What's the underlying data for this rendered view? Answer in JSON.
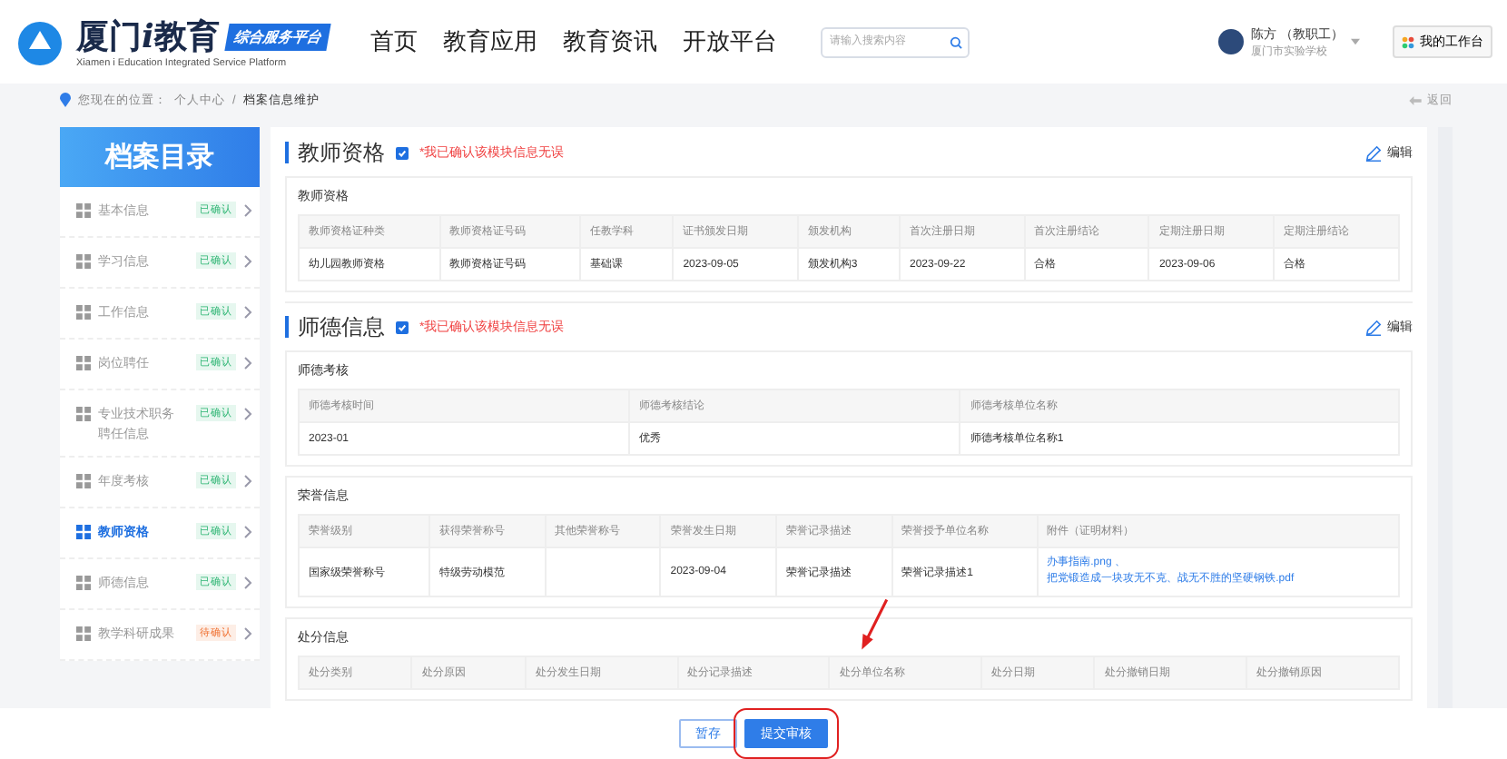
{
  "header": {
    "logo_title": "厦门",
    "logo_i": "i",
    "logo_title2": "教育",
    "logo_badge": "综合服务平台",
    "logo_subtitle": "Xiamen i Education Integrated Service Platform",
    "nav": [
      {
        "label": "首页",
        "selected": false
      },
      {
        "label": "教育应用",
        "selected": false
      },
      {
        "label": "教育资讯",
        "selected": false
      },
      {
        "label": "开放平台",
        "selected": false
      }
    ],
    "search": {
      "placeholder": "请输入搜索内容"
    },
    "user": {
      "name": "陈方 （教职工）",
      "org": "厦门市实验学校"
    },
    "workbench": "我的工作台"
  },
  "breadcrumb": {
    "prefix": "您现在的位置：",
    "items": [
      "个人中心",
      "档案信息维护"
    ],
    "separator": "/",
    "back": "返回"
  },
  "sidebar": {
    "title": "档案目录",
    "items": [
      {
        "label": "基本信息",
        "status": "已确认",
        "kind": "done",
        "selected": false
      },
      {
        "label": "学习信息",
        "status": "已确认",
        "kind": "done",
        "selected": false
      },
      {
        "label": "工作信息",
        "status": "已确认",
        "kind": "done",
        "selected": false
      },
      {
        "label": "岗位聘任",
        "status": "已确认",
        "kind": "done",
        "selected": false
      },
      {
        "label": "专业技术职务聘任信息",
        "status": "已确认",
        "kind": "done",
        "selected": false
      },
      {
        "label": "年度考核",
        "status": "已确认",
        "kind": "done",
        "selected": false
      },
      {
        "label": "教师资格",
        "status": "已确认",
        "kind": "done",
        "selected": true
      },
      {
        "label": "师德信息",
        "status": "已确认",
        "kind": "done",
        "selected": false
      },
      {
        "label": "教学科研成果",
        "status": "待确认",
        "kind": "pending",
        "selected": false
      }
    ]
  },
  "sections": [
    {
      "title": "教师资格",
      "confirm": {
        "checked": true,
        "label": "*我已确认该模块信息无误"
      },
      "edit": "编辑",
      "cards": [
        {
          "title": "教师资格",
          "columns": [
            "教师资格证种类",
            "教师资格证号码",
            "任教学科",
            "证书颁发日期",
            "颁发机构",
            "首次注册日期",
            "首次注册结论",
            "定期注册日期",
            "定期注册结论"
          ],
          "rows": [
            [
              "幼儿园教师资格",
              "教师资格证号码",
              "基础课",
              "2023-09-05",
              "颁发机构3",
              "2023-09-22",
              "合格",
              "2023-09-06",
              "合格"
            ]
          ]
        }
      ]
    },
    {
      "title": "师德信息",
      "confirm": {
        "checked": true,
        "label": "*我已确认该模块信息无误"
      },
      "edit": "编辑",
      "cards": [
        {
          "title": "师德考核",
          "columns": [
            "师德考核时间",
            "师德考核结论",
            "师德考核单位名称"
          ],
          "rows": [
            [
              "2023-01",
              "优秀",
              "师德考核单位名称1"
            ]
          ]
        },
        {
          "title": "荣誉信息",
          "columns": [
            "荣誉级别",
            "获得荣誉称号",
            "其他荣誉称号",
            "荣誉发生日期",
            "荣誉记录描述",
            "荣誉授予单位名称",
            "附件（证明材料）"
          ],
          "rows": [
            [
              "国家级荣誉称号",
              "特级劳动模范",
              "",
              "2023-09-04",
              "荣誉记录描述",
              "荣誉记录描述1",
              {
                "links": [
                  "办事指南.png 、",
                  "把党锻造成一块攻无不克、战无不胜的坚硬钢铁.pdf"
                ]
              }
            ]
          ]
        },
        {
          "title": "处分信息",
          "columns": [
            "处分类别",
            "处分原因",
            "处分发生日期",
            "处分记录描述",
            "处分单位名称",
            "处分日期",
            "处分撤销日期",
            "处分撤销原因"
          ]
        }
      ]
    }
  ],
  "footer": {
    "buttons": [
      {
        "label": "暂存",
        "kind": "secondary",
        "highlighted": false
      },
      {
        "label": "提交审核",
        "kind": "primary",
        "highlighted": true
      }
    ]
  }
}
